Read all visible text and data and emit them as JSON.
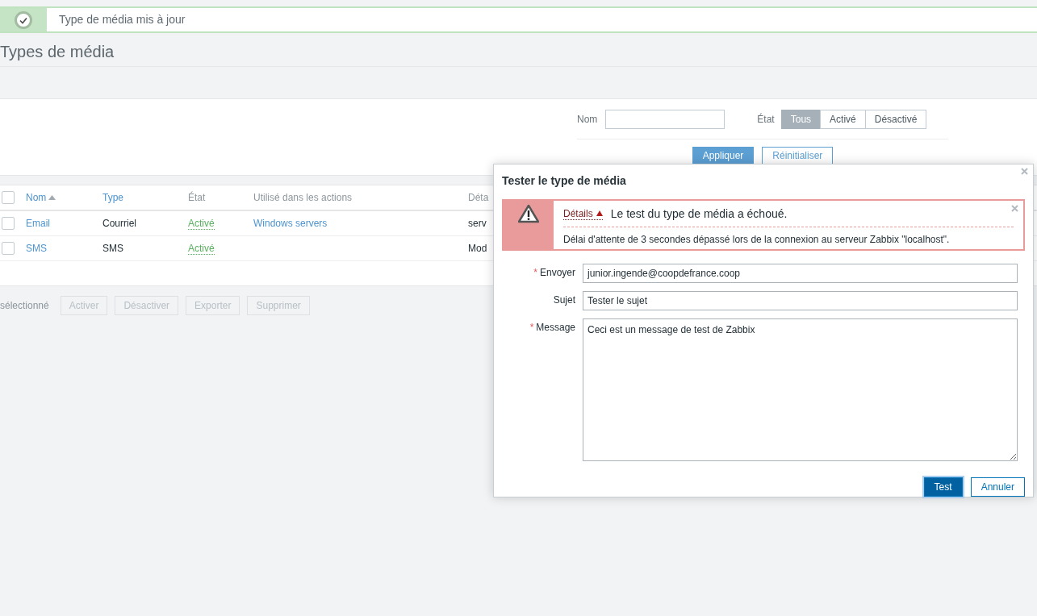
{
  "message": {
    "kind": "success",
    "text": "Type de média mis à jour"
  },
  "page_title": "Types de média",
  "filter": {
    "name_label": "Nom",
    "state_label": "État",
    "state_options": [
      {
        "label": "Tous",
        "selected": true
      },
      {
        "label": "Activé",
        "selected": false
      },
      {
        "label": "Désactivé",
        "selected": false
      }
    ],
    "buttons": [
      {
        "label": "Appliquer",
        "primary": true
      },
      {
        "label": "Réinitialiser",
        "primary": false
      }
    ]
  },
  "table": {
    "select_all_checked": false,
    "columns": [
      {
        "label": "Nom",
        "sortable": true,
        "sorted": true
      },
      {
        "label": "Type",
        "sortable": true,
        "sorted": false
      },
      {
        "label": "État",
        "sortable": false,
        "sorted": false
      },
      {
        "label": "Utilisé dans les actions",
        "sortable": false,
        "sorted": false
      },
      {
        "label": "Déta",
        "sortable": false,
        "sorted": false
      }
    ],
    "rows": [
      {
        "checked": false,
        "name": "Email",
        "type": "Courriel",
        "status": "Activé",
        "enabled": true,
        "actions": "Windows servers",
        "details": "serv"
      },
      {
        "checked": false,
        "name": "SMS",
        "type": "SMS",
        "status": "Activé",
        "enabled": true,
        "details": "Mod"
      }
    ]
  },
  "footer": {
    "selected_count": "sélectionné",
    "buttons": [
      {
        "label": "Activer",
        "disabled": true
      },
      {
        "label": "Désactiver",
        "disabled": true
      },
      {
        "label": "Exporter",
        "disabled": true
      },
      {
        "label": "Supprimer",
        "disabled": true
      }
    ]
  },
  "dialog": {
    "title": "Tester le type de média",
    "alert": {
      "kind": "error",
      "details_link": "Détails",
      "expanded": true,
      "summary": "Le test du type de média a échoué.",
      "detail": "Délai d'attente de 3 secondes dépassé lors de la connexion au serveur Zabbix \"localhost\"."
    },
    "fields": [
      {
        "kind": "input",
        "required_mark": "*",
        "label": "Envoyer",
        "value": "junior.ingende@coopdefrance.coop"
      },
      {
        "kind": "input",
        "label": "Sujet",
        "value": "Tester le sujet"
      },
      {
        "kind": "textarea",
        "required_mark": "*",
        "label": "Message",
        "value": "Ceci est un message de test de Zabbix"
      }
    ],
    "buttons": [
      {
        "label": "Test",
        "primary": true
      },
      {
        "label": "Annuler",
        "primary": false
      }
    ]
  }
}
